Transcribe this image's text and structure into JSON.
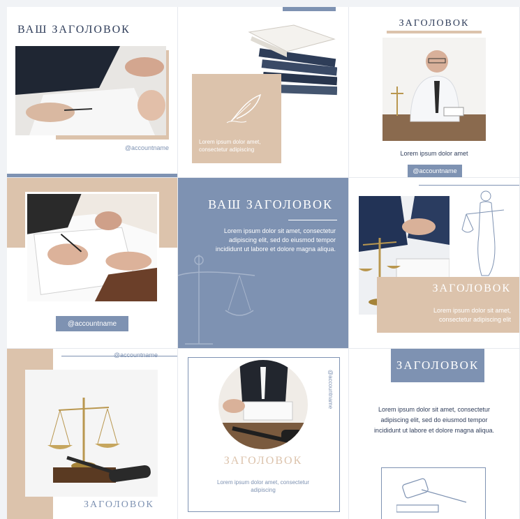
{
  "colors": {
    "blue": "#7e92b2",
    "beige": "#dcc3ac",
    "navy": "#2f3d5a",
    "white": "#ffffff"
  },
  "tiles": {
    "t1": {
      "title": "ВАШ ЗАГОЛОВОК",
      "handle": "@accountname"
    },
    "t2": {
      "text": "Lorem ipsum dolor amet, consectetur adipiscing",
      "icon": "feather-icon"
    },
    "t3": {
      "title": "ЗАГОЛОВОК",
      "caption": "Lorem ipsum dolor amet",
      "handle": "@accountname"
    },
    "t4": {
      "handle": "@accountname"
    },
    "t5": {
      "title": "ВАШ ЗАГОЛОВОК",
      "body": "Lorem ipsum dolor sit amet, consectetur adipiscing elit, sed do eiusmod tempor incididunt ut labore et dolore magna aliqua.",
      "icon": "scales-icon"
    },
    "t6": {
      "title": "ЗАГОЛОВОК",
      "text": "Lorem ipsum dolor sit amet, consectetur adipiscing elit",
      "icon": "themis-icon"
    },
    "t7": {
      "handle": "@accountname",
      "title": "ЗАГОЛОВОК"
    },
    "t8": {
      "title": "ЗАГОЛОВОК",
      "text": "Lorem ipsum dolor amet, consectetur adipiscing",
      "handle": "@accountname"
    },
    "t9": {
      "title": "ЗАГОЛОВОК",
      "body": "Lorem ipsum dolor sit amet, consectetur adipiscing elit, sed do eiusmod tempor incididunt ut labore et dolore magna aliqua.",
      "icon": "gavel-icon"
    }
  }
}
